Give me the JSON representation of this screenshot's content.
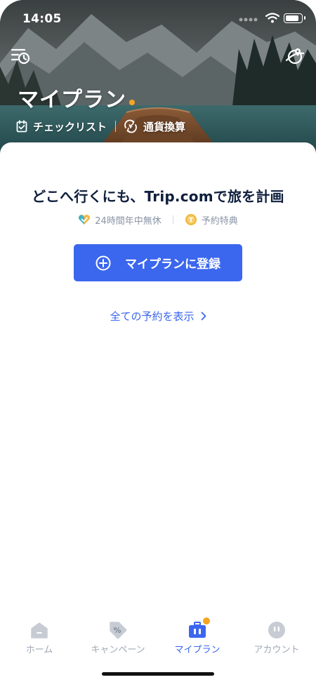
{
  "status_bar": {
    "time": "14:05"
  },
  "hero": {
    "title": "マイプラン",
    "links": [
      {
        "label": "チェックリスト",
        "icon": "checklist-icon"
      },
      {
        "label": "通貨換算",
        "icon": "currency-exchange-icon"
      }
    ],
    "left_icon": "history-icon",
    "right_icon": "globe-pin-icon",
    "dot_color": "#f5a623"
  },
  "main": {
    "headline": "どこへ行くにも、Trip.comで旅を計画",
    "features": [
      {
        "label": "24時間年中無休",
        "icon": "heart-check-icon"
      },
      {
        "label": "予約特典",
        "icon": "coin-icon"
      }
    ],
    "register_button": "マイプランに登録",
    "view_all_link": "全ての予約を表示"
  },
  "tab_bar": {
    "items": [
      {
        "label": "ホーム",
        "icon": "home-icon",
        "active": false
      },
      {
        "label": "キャンペーン",
        "icon": "tag-icon",
        "active": false
      },
      {
        "label": "マイプラン",
        "icon": "briefcase-icon",
        "active": true
      },
      {
        "label": "アカウント",
        "icon": "account-icon",
        "active": false
      }
    ]
  },
  "colors": {
    "accent": "#3b66ee",
    "text_dark": "#0f1f3d",
    "muted": "#a2a9b5",
    "badge": "#f5a623"
  }
}
